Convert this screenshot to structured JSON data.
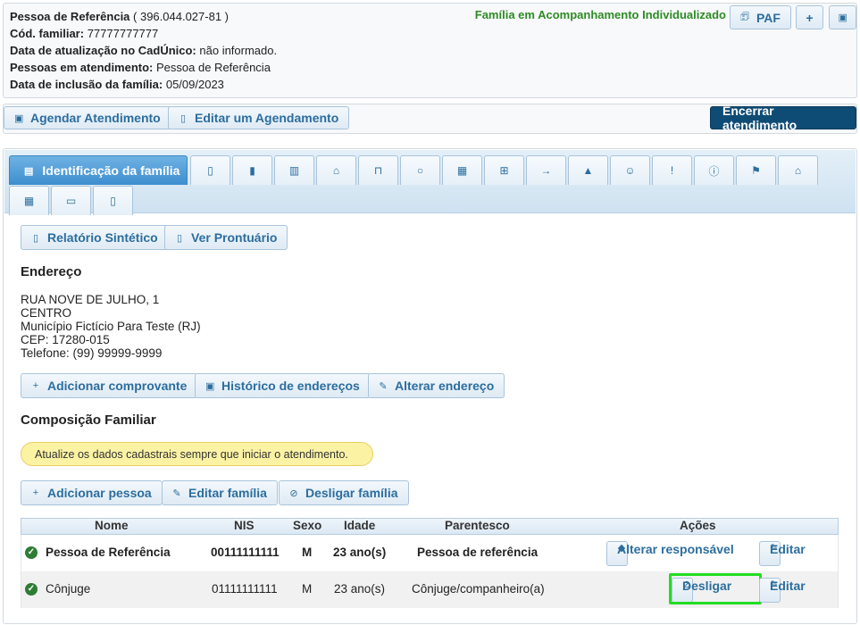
{
  "header": {
    "ref_label": "Pessoa de Referência",
    "ref_cpf": "( 396.044.027-81 )",
    "cod_label": "Cód. familiar:",
    "cod_value": "77777777777",
    "update_label": "Data de atualização no CadÚnico:",
    "update_value": "não informado.",
    "people_label": "Pessoas em atendimento:",
    "people_value": "Pessoa de Referência",
    "inclusion_label": "Data de inclusão da família:",
    "inclusion_value": "05/09/2023",
    "status": "Família em Acompanhamento Individualizado",
    "paf_label": "PAF",
    "plus_label": "+"
  },
  "actions": {
    "agendar": "Agendar Atendimento",
    "editar_agendamento": "Editar um Agendamento",
    "encerrar": "Encerrar atendimento"
  },
  "tabs": {
    "active_label": "Identificação da família",
    "icons": [
      "clipboard-icon",
      "book-icon",
      "library-icon",
      "home-icon",
      "bag-icon",
      "lightbulb-icon",
      "table-icon",
      "cart-icon",
      "arrow-right-icon",
      "warning-icon",
      "user-icon",
      "exclamation-icon",
      "info-icon",
      "flag-icon",
      "home-alt-icon",
      "grid-icon",
      "document-icon",
      "clipboard-alt-icon"
    ]
  },
  "buttons": {
    "relatorio": "Relatório Sintético",
    "prontuario": "Ver Prontuário",
    "comprovante": "Adicionar comprovante",
    "historico": "Histórico de endereços",
    "alterar_endereco": "Alterar endereço",
    "add_pessoa": "Adicionar pessoa",
    "editar_familia": "Editar família",
    "desligar_familia": "Desligar família"
  },
  "endereco": {
    "title": "Endereço",
    "line1": "RUA NOVE DE JULHO, 1",
    "line2": "CENTRO",
    "line3": "Município Fictício Para Teste (RJ)",
    "line4": "CEP: 17280-015",
    "line5": "Telefone: (99) 99999-9999"
  },
  "composicao": {
    "title": "Composição Familiar",
    "alert": "Atualize os dados cadastrais sempre que iniciar o atendimento."
  },
  "table": {
    "headers": {
      "nome": "Nome",
      "nis": "NIS",
      "sexo": "Sexo",
      "idade": "Idade",
      "parentesco": "Parentesco",
      "acoes": "Ações"
    },
    "rows": [
      {
        "nome": "Pessoa de Referência",
        "nis": "00111111111",
        "sexo": "M",
        "idade": "23 ano(s)",
        "parentesco": "Pessoa de referência",
        "action1": "Alterar responsável",
        "action2": "Editar"
      },
      {
        "nome": "Cônjuge",
        "nis": "01111111111",
        "sexo": "M",
        "idade": "23 ano(s)",
        "parentesco": "Cônjuge/companheiro(a)",
        "action1": "Desligar",
        "action2": "Editar"
      }
    ]
  },
  "colors": {
    "primary": "#2c6e9e",
    "dark_button": "#0f4c75",
    "status_green": "#2e8b24",
    "highlight": "#22dd22"
  }
}
